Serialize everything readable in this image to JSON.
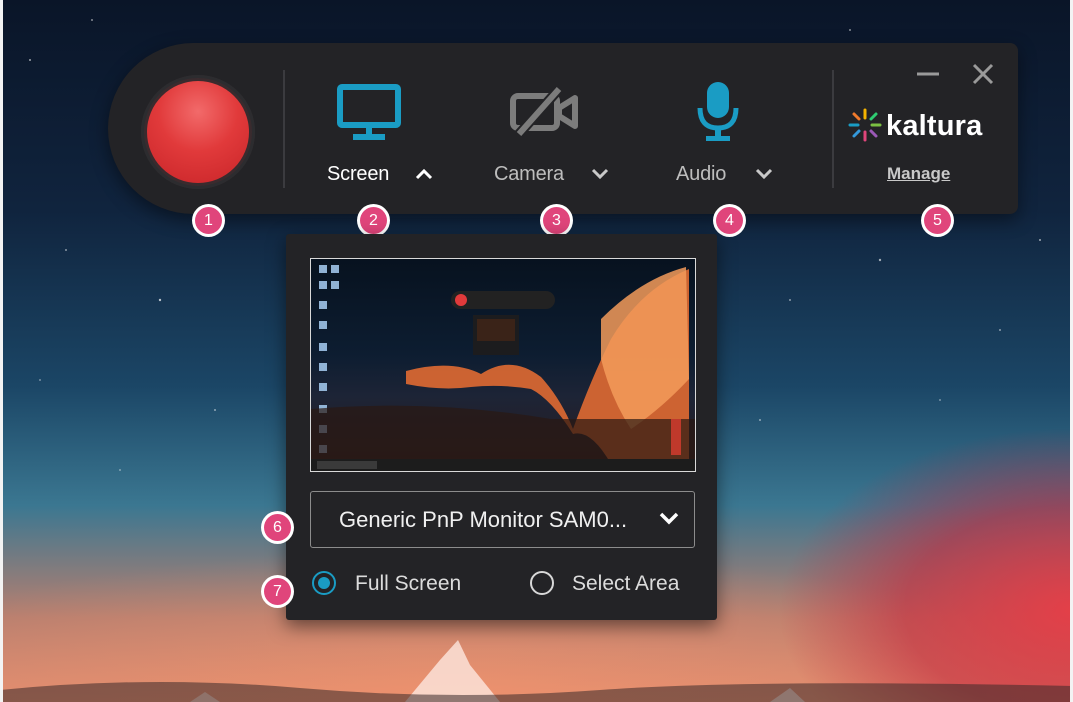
{
  "toolbar": {
    "screen_label": "Screen",
    "camera_label": "Camera",
    "audio_label": "Audio",
    "brand": "kaltura",
    "manage_label": "Manage"
  },
  "callouts": [
    "1",
    "2",
    "3",
    "4",
    "5",
    "6",
    "7"
  ],
  "panel": {
    "monitor_selected": "Generic PnP Monitor SAM0...",
    "option_full_screen": "Full Screen",
    "option_select_area": "Select Area",
    "selected_option": "Full Screen"
  },
  "icons": {
    "screen": "monitor-icon",
    "camera": "camera-off-icon",
    "audio": "microphone-icon",
    "expand_open": "chevron-up-icon",
    "expand_closed": "chevron-down-icon",
    "minimize": "minimize-icon",
    "close": "close-icon",
    "logo": "kaltura-logo-icon"
  },
  "colors": {
    "accent": "#1a9cc4",
    "record": "#e13a3b",
    "callout": "#e0457b",
    "toolbar_bg": "#232326"
  }
}
